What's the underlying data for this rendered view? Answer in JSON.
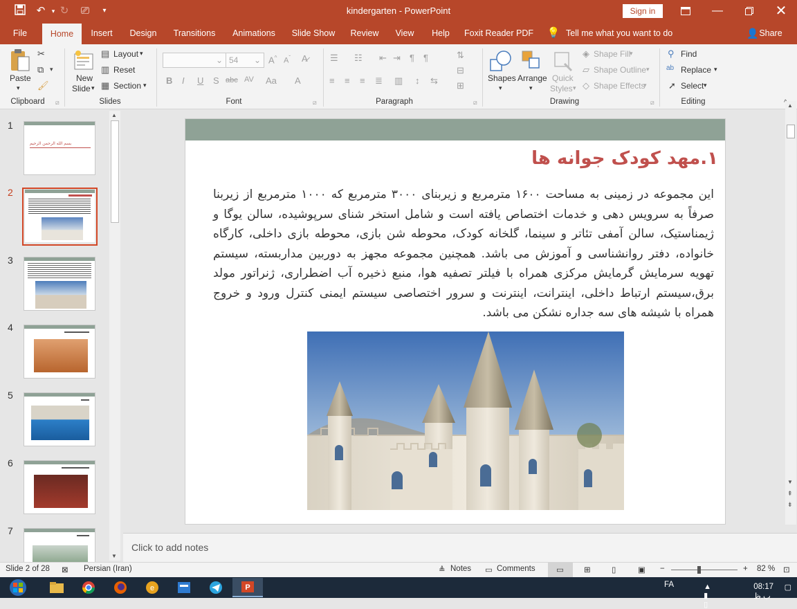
{
  "window": {
    "title": "kindergarten - PowerPoint",
    "signin": "Sign in"
  },
  "tabs": [
    "File",
    "Home",
    "Insert",
    "Design",
    "Transitions",
    "Animations",
    "Slide Show",
    "Review",
    "View",
    "Help",
    "Foxit Reader PDF"
  ],
  "tell_me": "Tell me what you want to do",
  "share": "Share",
  "ribbon": {
    "clipboard": {
      "label": "Clipboard",
      "paste": "Paste"
    },
    "slides": {
      "label": "Slides",
      "new_slide_1": "New",
      "new_slide_2": "Slide",
      "layout": "Layout",
      "reset": "Reset",
      "section": "Section"
    },
    "font": {
      "label": "Font",
      "size": "54"
    },
    "paragraph": {
      "label": "Paragraph"
    },
    "drawing": {
      "label": "Drawing",
      "shapes": "Shapes",
      "arrange": "Arrange",
      "quick_1": "Quick",
      "quick_2": "Styles",
      "shape_fill": "Shape Fill",
      "shape_outline": "Shape Outline",
      "shape_effects": "Shape Effects"
    },
    "editing": {
      "label": "Editing",
      "find": "Find",
      "replace": "Replace",
      "select": "Select"
    }
  },
  "thumbnails": {
    "numbers": [
      "1",
      "2",
      "3",
      "4",
      "5",
      "6",
      "7"
    ],
    "thumb1_text": "بسم الله الرحمن الرحیم"
  },
  "slide": {
    "title": "۱.مهد کودک جوانه ها",
    "body": "این مجموعه در زمینی به مساحت ۱۶۰۰ مترمربع و زیربنای ۳۰۰۰ مترمربع که ۱۰۰۰ مترمربع از زیربنا صرفاً به سرویس دهی و خدمات اختصاص یافته است و شامل استخر شنای سرپوشیده، سالن یوگا و ژیمناستیک، سالن آمفی تئاتر و سینما، گلخانه کودک، محوطه شن بازی، محوطه بازی داخلی، کارگاه خانواده، دفتر روانشناسی و آموزش می باشد. همچنین مجموعه مجهز به دوربین مداربسته، سیستم تهویه سرمایش گرمایش مرکزی همراه با فیلتر تصفیه هوا، منبع ذخیره آب اضطراری، ژنراتور مولد برق،سیستم ارتباط داخلی، اینترانت، اینترنت و سرور اختصاصی سیستم ایمنی کنترل ورود و خروج همراه با شیشه های سه جداره نشکن می باشد."
  },
  "notes_placeholder": "Click to add notes",
  "status": {
    "slide_of": "Slide 2 of 28",
    "language": "Persian (Iran)",
    "notes": "Notes",
    "comments": "Comments",
    "zoom": "82 %"
  },
  "taskbar": {
    "lang": "FA",
    "time": "08:17 ب.ظ"
  },
  "colors": {
    "accent": "#b7472a",
    "slide_header": "#8fa296",
    "title_red": "#c0504d"
  }
}
